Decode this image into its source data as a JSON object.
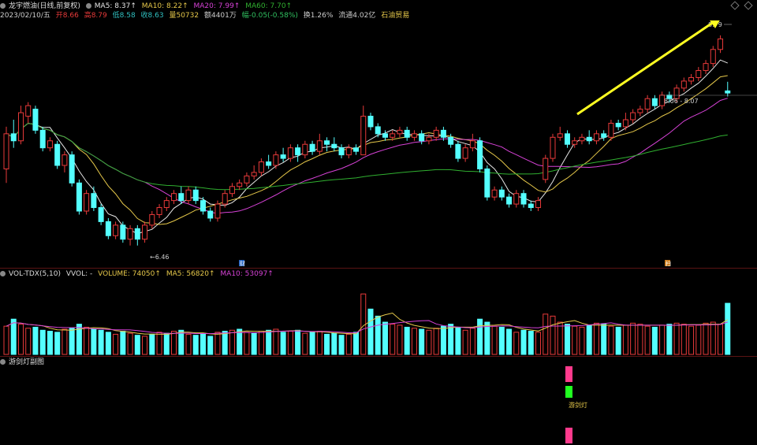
{
  "header": {
    "title": "龙宇燃油(日线,前复权)",
    "ma5": "MA5: 8.37↑",
    "ma10": "MA10: 8.22↑",
    "ma20": "MA20: 7.99↑",
    "ma60": "MA60: 7.70↑",
    "date": "2023/02/10/五",
    "open": "开8.66",
    "high": "高8.79",
    "low": "低8.58",
    "close": "收8.63",
    "volume": "量50732",
    "amount": "额4401万",
    "change": "幅-0.05(-0.58%)",
    "turnover": "换1.26%",
    "float": "流通4.02亿",
    "sector": "石油贸易"
  },
  "annotations": {
    "high_label": "8.79",
    "low_label": "←6.46",
    "range_label": "8.06 - 8.07",
    "marker_a": "财",
    "marker_b": "扫"
  },
  "volume_header": {
    "name": "VOL-TDX(5,10)",
    "vvol": "VVOL: -",
    "volume": "VOLUME: 74050↑",
    "ma5": "MA5: 56820↑",
    "ma10": "MA10: 53097↑"
  },
  "indicator": {
    "name": "游剑灯副图",
    "signal_label": "游剑灯"
  },
  "colors": {
    "up": "#e83a3a",
    "down": "#54ffff",
    "ma5": "#e6e6e6",
    "ma10": "#e6c84a",
    "ma20": "#d642d6",
    "ma60": "#30b030",
    "arrow": "#ffff22",
    "signal_pink": "#ff3a8c",
    "signal_green": "#20ff20"
  },
  "chart_data": {
    "type": "candlestick",
    "title": "龙宇燃油(日线,前复权)",
    "ylim": [
      6.3,
      8.95
    ],
    "candles": [
      [
        7.55,
        8.05,
        8.15,
        7.35
      ],
      [
        8.05,
        7.95,
        8.25,
        7.85
      ],
      [
        7.95,
        8.35,
        8.45,
        7.9
      ],
      [
        8.3,
        8.45,
        8.5,
        8.2
      ],
      [
        8.4,
        8.1,
        8.45,
        8.05
      ],
      [
        8.1,
        7.85,
        8.15,
        7.8
      ],
      [
        7.85,
        7.95,
        8.0,
        7.8
      ],
      [
        7.9,
        7.6,
        7.95,
        7.55
      ],
      [
        7.6,
        7.75,
        7.8,
        7.5
      ],
      [
        7.75,
        7.35,
        7.8,
        7.3
      ],
      [
        7.35,
        6.95,
        7.4,
        6.9
      ],
      [
        6.95,
        7.2,
        7.25,
        6.9
      ],
      [
        7.2,
        7.0,
        7.3,
        6.95
      ],
      [
        7.0,
        6.8,
        7.05,
        6.75
      ],
      [
        6.8,
        6.6,
        6.85,
        6.55
      ],
      [
        6.6,
        6.75,
        6.8,
        6.55
      ],
      [
        6.75,
        6.55,
        6.8,
        6.5
      ],
      [
        6.55,
        6.7,
        6.75,
        6.46
      ],
      [
        6.7,
        6.55,
        6.75,
        6.46
      ],
      [
        6.55,
        6.75,
        6.8,
        6.5
      ],
      [
        6.75,
        6.9,
        6.95,
        6.7
      ],
      [
        6.9,
        7.0,
        7.05,
        6.85
      ],
      [
        7.0,
        7.1,
        7.15,
        6.95
      ],
      [
        7.1,
        7.2,
        7.25,
        7.05
      ],
      [
        7.2,
        7.1,
        7.3,
        7.05
      ],
      [
        7.1,
        7.25,
        7.3,
        7.05
      ],
      [
        7.25,
        7.1,
        7.3,
        7.05
      ],
      [
        7.1,
        6.95,
        7.15,
        6.9
      ],
      [
        6.95,
        6.85,
        7.0,
        6.8
      ],
      [
        6.85,
        7.05,
        7.1,
        6.8
      ],
      [
        7.05,
        7.2,
        7.25,
        7.0
      ],
      [
        7.2,
        7.3,
        7.35,
        7.15
      ],
      [
        7.3,
        7.35,
        7.4,
        7.25
      ],
      [
        7.35,
        7.45,
        7.5,
        7.3
      ],
      [
        7.45,
        7.5,
        7.6,
        7.4
      ],
      [
        7.5,
        7.65,
        7.7,
        7.45
      ],
      [
        7.65,
        7.6,
        7.75,
        7.55
      ],
      [
        7.6,
        7.75,
        7.8,
        7.55
      ],
      [
        7.75,
        7.7,
        7.85,
        7.65
      ],
      [
        7.7,
        7.85,
        7.9,
        7.65
      ],
      [
        7.85,
        7.75,
        7.9,
        7.65
      ],
      [
        7.75,
        7.9,
        7.95,
        7.7
      ],
      [
        7.9,
        7.8,
        7.95,
        7.75
      ],
      [
        7.8,
        7.95,
        8.05,
        7.75
      ],
      [
        7.95,
        7.9,
        8.0,
        7.8
      ],
      [
        7.9,
        7.85,
        8.0,
        7.8
      ],
      [
        7.85,
        7.75,
        7.9,
        7.7
      ],
      [
        7.75,
        7.85,
        7.9,
        7.7
      ],
      [
        7.85,
        7.8,
        7.9,
        7.75
      ],
      [
        7.75,
        8.3,
        8.45,
        7.75
      ],
      [
        8.3,
        8.15,
        8.35,
        8.1
      ],
      [
        8.15,
        8.05,
        8.2,
        8.0
      ],
      [
        8.05,
        8.0,
        8.1,
        7.95
      ],
      [
        8.0,
        8.05,
        8.1,
        7.95
      ],
      [
        8.05,
        8.1,
        8.15,
        8.0
      ],
      [
        8.1,
        8.0,
        8.15,
        7.95
      ],
      [
        8.0,
        8.05,
        8.1,
        7.95
      ],
      [
        8.05,
        7.95,
        8.1,
        7.9
      ],
      [
        7.95,
        8.0,
        8.05,
        7.9
      ],
      [
        8.0,
        8.1,
        8.15,
        7.95
      ],
      [
        8.1,
        8.0,
        8.15,
        7.95
      ],
      [
        8.0,
        7.9,
        8.05,
        7.85
      ],
      [
        7.9,
        7.7,
        7.95,
        7.65
      ],
      [
        7.7,
        7.85,
        7.9,
        7.65
      ],
      [
        7.85,
        7.95,
        8.05,
        7.8
      ],
      [
        7.95,
        7.55,
        8.0,
        7.5
      ],
      [
        7.55,
        7.15,
        7.6,
        7.1
      ],
      [
        7.15,
        7.25,
        7.3,
        7.1
      ],
      [
        7.25,
        7.15,
        7.3,
        7.1
      ],
      [
        7.15,
        7.05,
        7.2,
        7.0
      ],
      [
        7.05,
        7.2,
        7.25,
        7.0
      ],
      [
        7.2,
        7.05,
        7.25,
        7.0
      ],
      [
        7.05,
        7.0,
        7.1,
        6.95
      ],
      [
        7.0,
        7.1,
        7.15,
        6.95
      ],
      [
        7.4,
        7.7,
        7.75,
        7.35
      ],
      [
        7.7,
        8.0,
        8.05,
        7.65
      ],
      [
        8.0,
        8.05,
        8.15,
        7.95
      ],
      [
        8.05,
        7.9,
        8.1,
        7.85
      ],
      [
        7.9,
        7.95,
        8.0,
        7.85
      ],
      [
        7.95,
        8.0,
        8.05,
        7.9
      ],
      [
        8.0,
        7.95,
        8.1,
        7.9
      ],
      [
        7.95,
        8.05,
        8.1,
        7.9
      ],
      [
        8.05,
        8.0,
        8.1,
        7.95
      ],
      [
        8.0,
        8.2,
        8.25,
        7.95
      ],
      [
        8.2,
        8.15,
        8.25,
        8.1
      ],
      [
        8.15,
        8.25,
        8.35,
        8.1
      ],
      [
        8.25,
        8.35,
        8.4,
        8.2
      ],
      [
        8.35,
        8.4,
        8.45,
        8.3
      ],
      [
        8.4,
        8.55,
        8.6,
        8.35
      ],
      [
        8.55,
        8.45,
        8.6,
        8.4
      ],
      [
        8.45,
        8.6,
        8.65,
        8.4
      ],
      [
        8.6,
        8.55,
        8.65,
        8.5
      ],
      [
        8.55,
        8.7,
        8.75,
        8.5
      ],
      [
        8.7,
        8.8,
        8.85,
        8.65
      ],
      [
        8.8,
        8.85,
        8.9,
        8.75
      ],
      [
        8.85,
        8.95,
        9.0,
        8.8
      ],
      [
        8.95,
        9.05,
        9.1,
        8.9
      ],
      [
        9.05,
        9.25,
        9.3,
        9.0
      ],
      [
        9.25,
        9.4,
        9.45,
        9.2
      ],
      [
        8.66,
        8.63,
        8.79,
        8.58
      ]
    ],
    "volumes": [
      28000,
      35000,
      30000,
      26000,
      27000,
      24000,
      23000,
      22000,
      25000,
      26000,
      30000,
      27000,
      25000,
      24000,
      22000,
      20000,
      23000,
      21000,
      19000,
      18000,
      20000,
      22000,
      21000,
      23000,
      24000,
      20000,
      19000,
      21000,
      18000,
      22000,
      23000,
      24000,
      25000,
      22000,
      21000,
      23000,
      24000,
      25000,
      22000,
      23000,
      24000,
      21000,
      22000,
      23000,
      20000,
      21000,
      19000,
      20000,
      22000,
      60000,
      45000,
      38000,
      32000,
      30000,
      29000,
      27000,
      26000,
      25000,
      24000,
      26000,
      28000,
      30000,
      27000,
      24000,
      26000,
      35000,
      32000,
      28000,
      27000,
      25000,
      22000,
      24000,
      23000,
      22000,
      40000,
      38000,
      32000,
      30000,
      28000,
      27000,
      29000,
      31000,
      30000,
      28000,
      27000,
      29000,
      31000,
      30000,
      28000,
      27000,
      29000,
      30000,
      31000,
      30000,
      28000,
      29000,
      31000,
      32000,
      30000,
      50732
    ],
    "volume_up_index": [
      0,
      2,
      3,
      8,
      11,
      15,
      17,
      19,
      21,
      23,
      25,
      29,
      31,
      33,
      35,
      37,
      39,
      41,
      43,
      47,
      49,
      53,
      54,
      56,
      58,
      59,
      63,
      64,
      67,
      70,
      73,
      74,
      75,
      76,
      78,
      79,
      81,
      83,
      85,
      86,
      87,
      88,
      90,
      92,
      93,
      94,
      95,
      96,
      97,
      98
    ],
    "xlabel": "",
    "ylabel": ""
  }
}
